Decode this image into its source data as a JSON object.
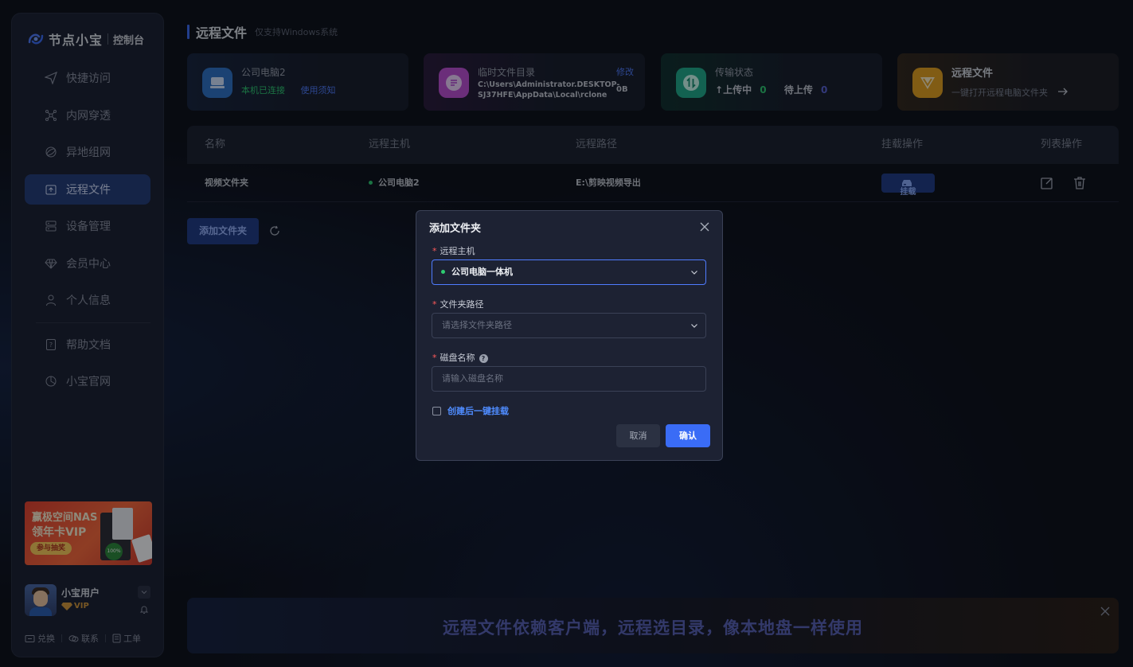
{
  "brand": {
    "name": "节点小宝",
    "console": "控制台"
  },
  "sidebar": {
    "items": [
      {
        "label": "快捷访问",
        "icon": "send-icon"
      },
      {
        "label": "内网穿透",
        "icon": "network-icon"
      },
      {
        "label": "异地组网",
        "icon": "globe-icon"
      },
      {
        "label": "远程文件",
        "icon": "upload-folder-icon",
        "active": true
      },
      {
        "label": "设备管理",
        "icon": "server-icon"
      },
      {
        "label": "会员中心",
        "icon": "diamond-icon"
      },
      {
        "label": "个人信息",
        "icon": "user-icon"
      },
      {
        "label": "帮助文档",
        "icon": "help-doc-icon"
      },
      {
        "label": "小宝官网",
        "icon": "pie-icon"
      }
    ],
    "promo": {
      "line1": "赢极空间NAS",
      "line2": "领年卡VIP",
      "button": "参与抽奖",
      "badge": "100%中奖"
    },
    "user": {
      "name": "小宝用户",
      "vip": "VIP"
    },
    "links": [
      "兑换",
      "联系",
      "工单"
    ]
  },
  "header": {
    "title": "远程文件",
    "subtitle": "仅支持Windows系统"
  },
  "cards": {
    "pc": {
      "title": "公司电脑2",
      "status": "本机已连接",
      "link": "使用须知"
    },
    "temp": {
      "title": "临时文件目录",
      "edit": "修改",
      "path_line1": "C:\\Users\\Administrator.DESKTOP-",
      "path_line2": "SJ37HFE\\AppData\\Local\\rclone",
      "size": "0B"
    },
    "transfer": {
      "title": "传输状态",
      "uploading_label": "上传中",
      "uploading_count": "0",
      "pending_label": "待上传",
      "pending_count": "0"
    },
    "remote": {
      "title": "远程文件",
      "desc": "一键打开远程电脑文件夹"
    }
  },
  "table": {
    "headers": [
      "名称",
      "远程主机",
      "远程路径",
      "挂载操作",
      "列表操作"
    ],
    "rows": [
      {
        "name": "视频文件夹",
        "host": "公司电脑2",
        "path": "E:\\剪映视频导出",
        "mount": "挂载"
      }
    ]
  },
  "actions": {
    "add_folder": "添加文件夹"
  },
  "banner": {
    "text": "远程文件依赖客户端，远程选目录，像本地盘一样使用"
  },
  "modal": {
    "title": "添加文件夹",
    "host_label": "远程主机",
    "host_value": "公司电脑一体机",
    "path_label": "文件夹路径",
    "path_placeholder": "请选择文件夹路径",
    "disk_label": "磁盘名称",
    "disk_placeholder": "请输入磁盘名称",
    "checkbox_label": "创建后一键挂载",
    "cancel": "取消",
    "confirm": "确认"
  },
  "colors": {
    "accent": "#3a6cf6",
    "success": "#2ecc71",
    "danger": "#ff5a5a",
    "vip": "#d79a3a"
  }
}
